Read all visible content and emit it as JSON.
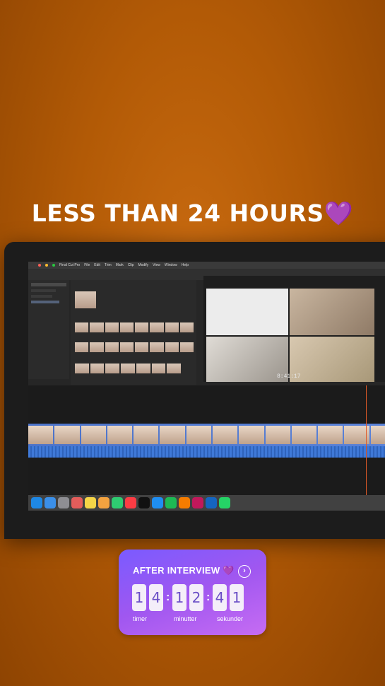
{
  "headline": {
    "text": "LESS THAN 24 HOURS",
    "emoji": "💜"
  },
  "screen": {
    "menu": [
      "Final Cut Pro",
      "File",
      "Edit",
      "Trim",
      "Mark",
      "Clip",
      "Modify",
      "View",
      "Window",
      "Help"
    ],
    "timecode": "8:41:17"
  },
  "countdown": {
    "title": "AFTER INTERVIEW",
    "emoji": "💜",
    "arrow": "›",
    "digits": [
      "1",
      "4",
      "1",
      "2",
      "4",
      "1"
    ],
    "units": [
      "timer",
      "minutter",
      "sekunder"
    ]
  },
  "colors": {
    "background": "#b25a06",
    "sticker_gradient_start": "#7a5bff",
    "sticker_gradient_end": "#c66cf3"
  }
}
